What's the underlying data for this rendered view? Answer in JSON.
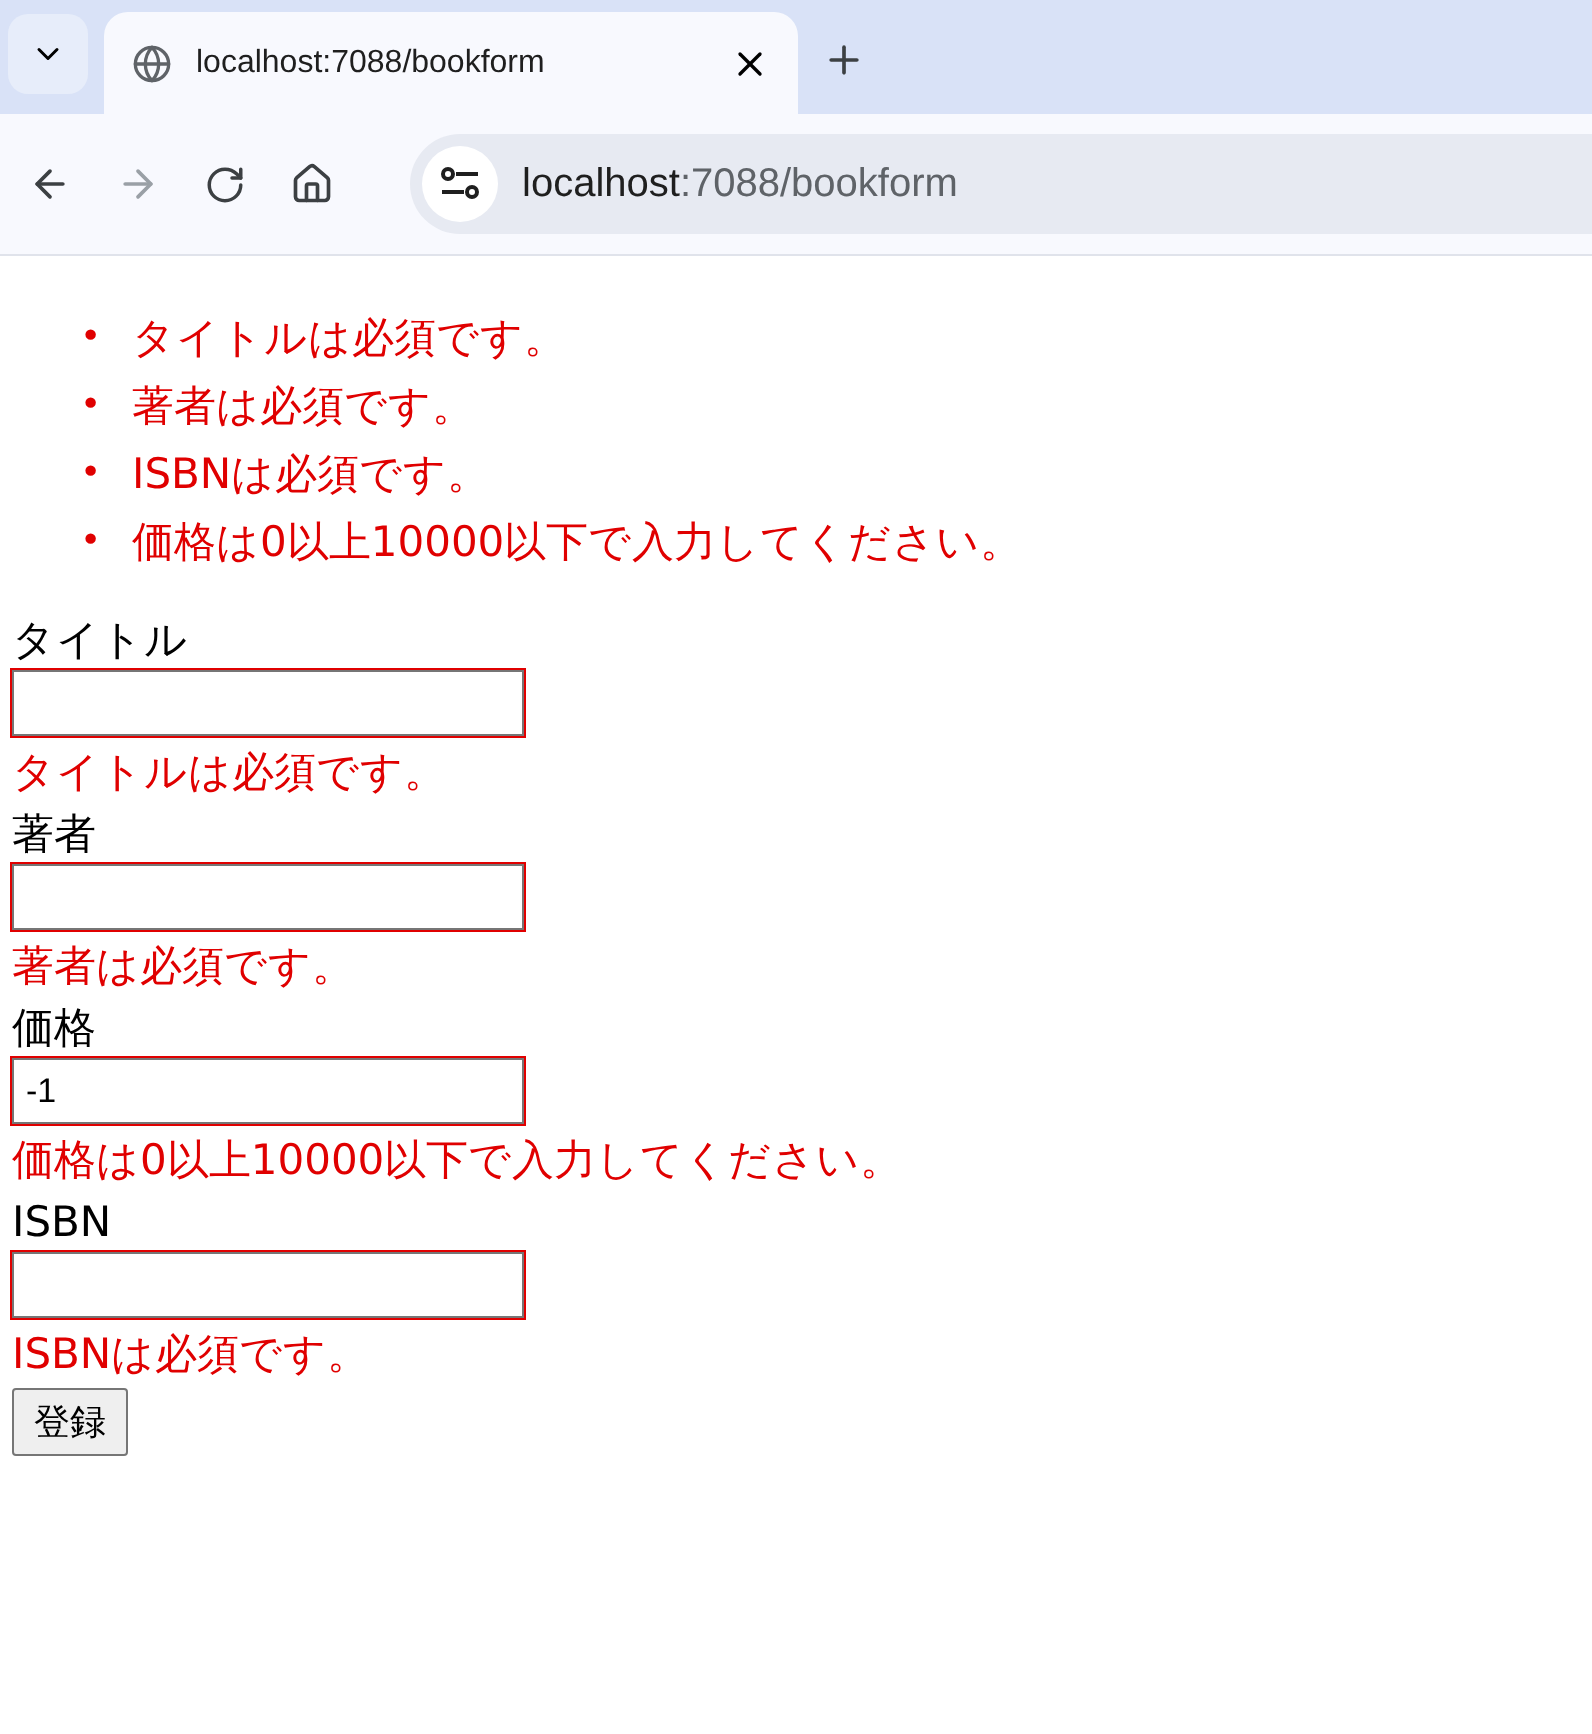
{
  "browser": {
    "tab": {
      "title": "localhost:7088/bookform"
    },
    "address": {
      "host": "localhost",
      "rest": ":7088/bookform"
    },
    "forward_disabled": true
  },
  "summary": [
    {
      "marker": "•",
      "text": "タイトルは必須です。"
    },
    {
      "marker": "•",
      "text": "著者は必須です。"
    },
    {
      "marker": "•",
      "text": "ISBNは必須です。"
    },
    {
      "marker": "•",
      "text": "価格は0以上10000以下で入力してください。"
    }
  ],
  "fields": [
    {
      "label": "タイトル",
      "invalid": true,
      "error": "タイトルは必須です。"
    },
    {
      "label": "著者",
      "invalid": true,
      "error": "著者は必須です。"
    },
    {
      "label": "価格",
      "value": "-1",
      "invalid": true,
      "error": "価格は0以上10000以下で入力してください。"
    },
    {
      "label": "ISBN",
      "invalid": true,
      "error": "ISBNは必須です。"
    }
  ],
  "submit": "登録"
}
